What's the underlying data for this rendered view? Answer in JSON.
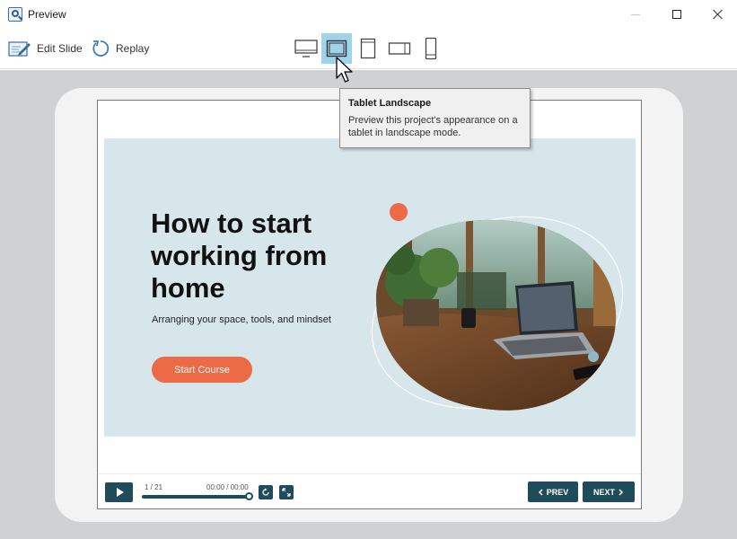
{
  "window": {
    "title": "Preview"
  },
  "toolbar": {
    "edit_label": "Edit Slide",
    "replay_label": "Replay",
    "devices": [
      {
        "name": "desktop",
        "active": false
      },
      {
        "name": "tablet-landscape",
        "active": true
      },
      {
        "name": "tablet-portrait",
        "active": false
      },
      {
        "name": "phone-landscape",
        "active": false
      },
      {
        "name": "phone-portrait",
        "active": false
      }
    ]
  },
  "tooltip": {
    "title": "Tablet Landscape",
    "body": "Preview this project's appearance on a tablet in landscape mode."
  },
  "slide": {
    "headline": "How to start working from home",
    "subtitle": "Arranging your space, tools, and mindset",
    "button_label": "Start Course"
  },
  "player": {
    "page_counter": "1 / 21",
    "time": "00:00 / 00:00",
    "prev_label": "PREV",
    "next_label": "NEXT",
    "progress": 1.0
  },
  "colors": {
    "accent": "#1e4c5a",
    "cta": "#ec6a45",
    "slide_bg": "#d7e6eb",
    "device_active": "#9fd3ec"
  }
}
